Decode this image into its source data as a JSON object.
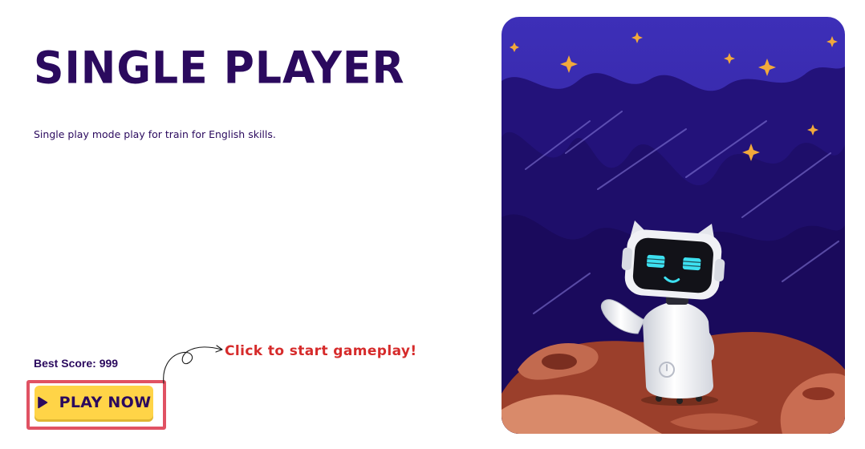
{
  "header": {
    "title": "SINGLE PLAYER",
    "description": "Single play mode play for train for English skills."
  },
  "score": {
    "label": "Best Score: 999"
  },
  "actions": {
    "play_label": "PLAY NOW",
    "play_icon": "play-icon"
  },
  "annotation": {
    "text": "Click to start gameplay!",
    "color": "#d62b2b"
  },
  "hero": {
    "scene": "robot-on-planet-illustration"
  },
  "colors": {
    "brand": "#2b0a5e",
    "button": "#ffd447",
    "highlight": "#e05263"
  }
}
